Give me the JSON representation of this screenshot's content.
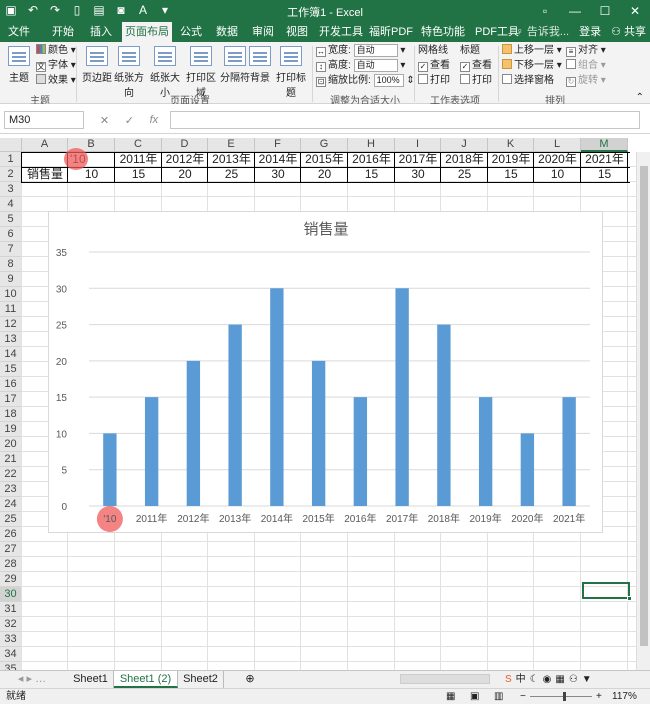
{
  "titlebar": {
    "title": "工作簿1 - Excel",
    "min": "—",
    "max": "☐",
    "close": "✕"
  },
  "tabs": [
    "文件",
    "开始",
    "插入",
    "页面布局",
    "公式",
    "数据",
    "审阅",
    "视图",
    "开发工具",
    "福昕PDF",
    "特色功能",
    "PDF工具集"
  ],
  "active_tab": "页面布局",
  "tell_me": "♀ 告诉我...",
  "login": "登录",
  "share": "共享",
  "ribbon": {
    "theme": {
      "label": "主题",
      "colors": "颜色",
      "fonts": "字体",
      "effects": "效果",
      "group": "主题"
    },
    "page_setup": {
      "margins": "页边距",
      "orientation": "纸张方向",
      "size": "纸张大小",
      "print_area": "打印区域",
      "breaks": "分隔符",
      "background": "背景",
      "print_titles": "打印标题",
      "group": "页面设置"
    },
    "scale": {
      "width": "宽度:",
      "width_val": "自动",
      "height": "高度:",
      "height_val": "自动",
      "scale": "缩放比例:",
      "scale_val": "100%",
      "group": "调整为合适大小"
    },
    "sheet_options": {
      "gridlines": "网格线",
      "headings": "标题",
      "view1": "查看",
      "view2": "查看",
      "print1": "打印",
      "print2": "打印",
      "group": "工作表选项"
    },
    "arrange": {
      "forward": "上移一层",
      "backward": "下移一层",
      "pane": "选择窗格",
      "align": "对齐",
      "group_btn": "组合",
      "rotate": "旋转",
      "group": "排列"
    }
  },
  "formula": {
    "namebox": "M30",
    "cancel": "✕",
    "enter": "✓",
    "fx": "fx",
    "value": ""
  },
  "columns": [
    "A",
    "B",
    "C",
    "D",
    "E",
    "F",
    "G",
    "H",
    "I",
    "J",
    "K",
    "L",
    "M"
  ],
  "rows": [
    "1",
    "2",
    "3",
    "4",
    "5",
    "6",
    "7",
    "8",
    "9",
    "10",
    "11",
    "12",
    "13",
    "14",
    "15",
    "16",
    "17",
    "18",
    "19",
    "20",
    "21",
    "22",
    "23",
    "24",
    "25",
    "26",
    "27",
    "28",
    "29",
    "30",
    "31",
    "32",
    "33",
    "34",
    "35"
  ],
  "table": {
    "row1": [
      "",
      "'10",
      "2011年",
      "2012年",
      "2013年",
      "2014年",
      "2015年",
      "2016年",
      "2017年",
      "2018年",
      "2019年",
      "2020年",
      "2021年"
    ],
    "row2": [
      "销售量",
      "10",
      "15",
      "20",
      "25",
      "30",
      "20",
      "15",
      "30",
      "25",
      "15",
      "10",
      "15"
    ]
  },
  "chart_data": {
    "type": "bar",
    "title": "销售量",
    "categories": [
      "'10",
      "2011年",
      "2012年",
      "2013年",
      "2014年",
      "2015年",
      "2016年",
      "2017年",
      "2018年",
      "2019年",
      "2020年",
      "2021年"
    ],
    "values": [
      10,
      15,
      20,
      25,
      30,
      20,
      15,
      30,
      25,
      15,
      10,
      15
    ],
    "ylim": [
      0,
      35
    ],
    "yticks": [
      0,
      5,
      10,
      15,
      20,
      25,
      30,
      35
    ],
    "grid": true,
    "bar_color": "#5b9bd5"
  },
  "sheets": [
    "Sheet1",
    "Sheet1 (2)",
    "Sheet2"
  ],
  "active_sheet": "Sheet1 (2)",
  "status": {
    "ready": "就绪",
    "zoom": "117%"
  },
  "colors": {
    "excel_green": "#217346",
    "marker": "#f05a5a"
  }
}
